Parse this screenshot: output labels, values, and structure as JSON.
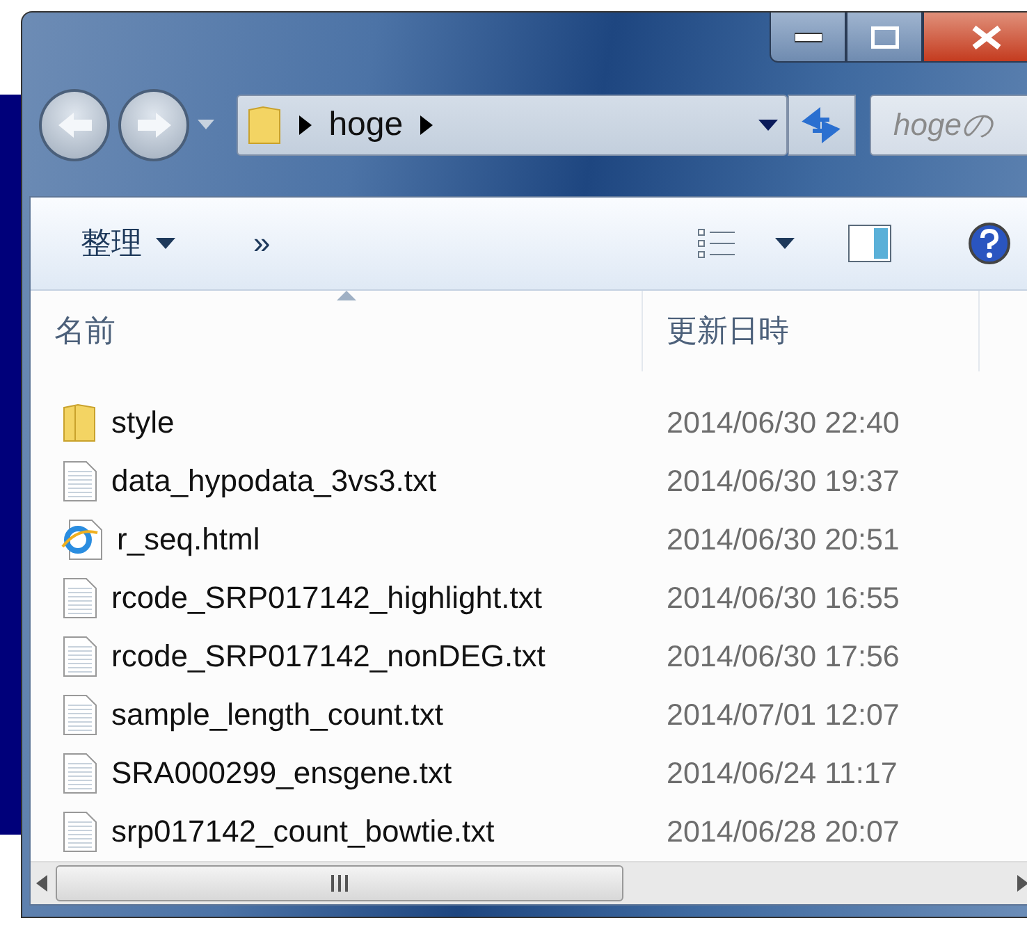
{
  "address": {
    "path": [
      "hoge"
    ]
  },
  "search": {
    "placeholder": "hogeの"
  },
  "toolbar": {
    "organize": "整理",
    "more": "»"
  },
  "columns": [
    {
      "label": "名前",
      "sorted": true
    },
    {
      "label": "更新日時",
      "sorted": false
    }
  ],
  "files": [
    {
      "name": "style",
      "date": "2014/06/30 22:40",
      "kind": "folder"
    },
    {
      "name": "data_hypodata_3vs3.txt",
      "date": "2014/06/30 19:37",
      "kind": "text"
    },
    {
      "name": "r_seq.html",
      "date": "2014/06/30 20:51",
      "kind": "html"
    },
    {
      "name": "rcode_SRP017142_highlight.txt",
      "date": "2014/06/30 16:55",
      "kind": "text"
    },
    {
      "name": "rcode_SRP017142_nonDEG.txt",
      "date": "2014/06/30 17:56",
      "kind": "text"
    },
    {
      "name": "sample_length_count.txt",
      "date": "2014/07/01 12:07",
      "kind": "text"
    },
    {
      "name": "SRA000299_ensgene.txt",
      "date": "2014/06/24 11:17",
      "kind": "text"
    },
    {
      "name": "srp017142_count_bowtie.txt",
      "date": "2014/06/28 20:07",
      "kind": "text"
    }
  ]
}
